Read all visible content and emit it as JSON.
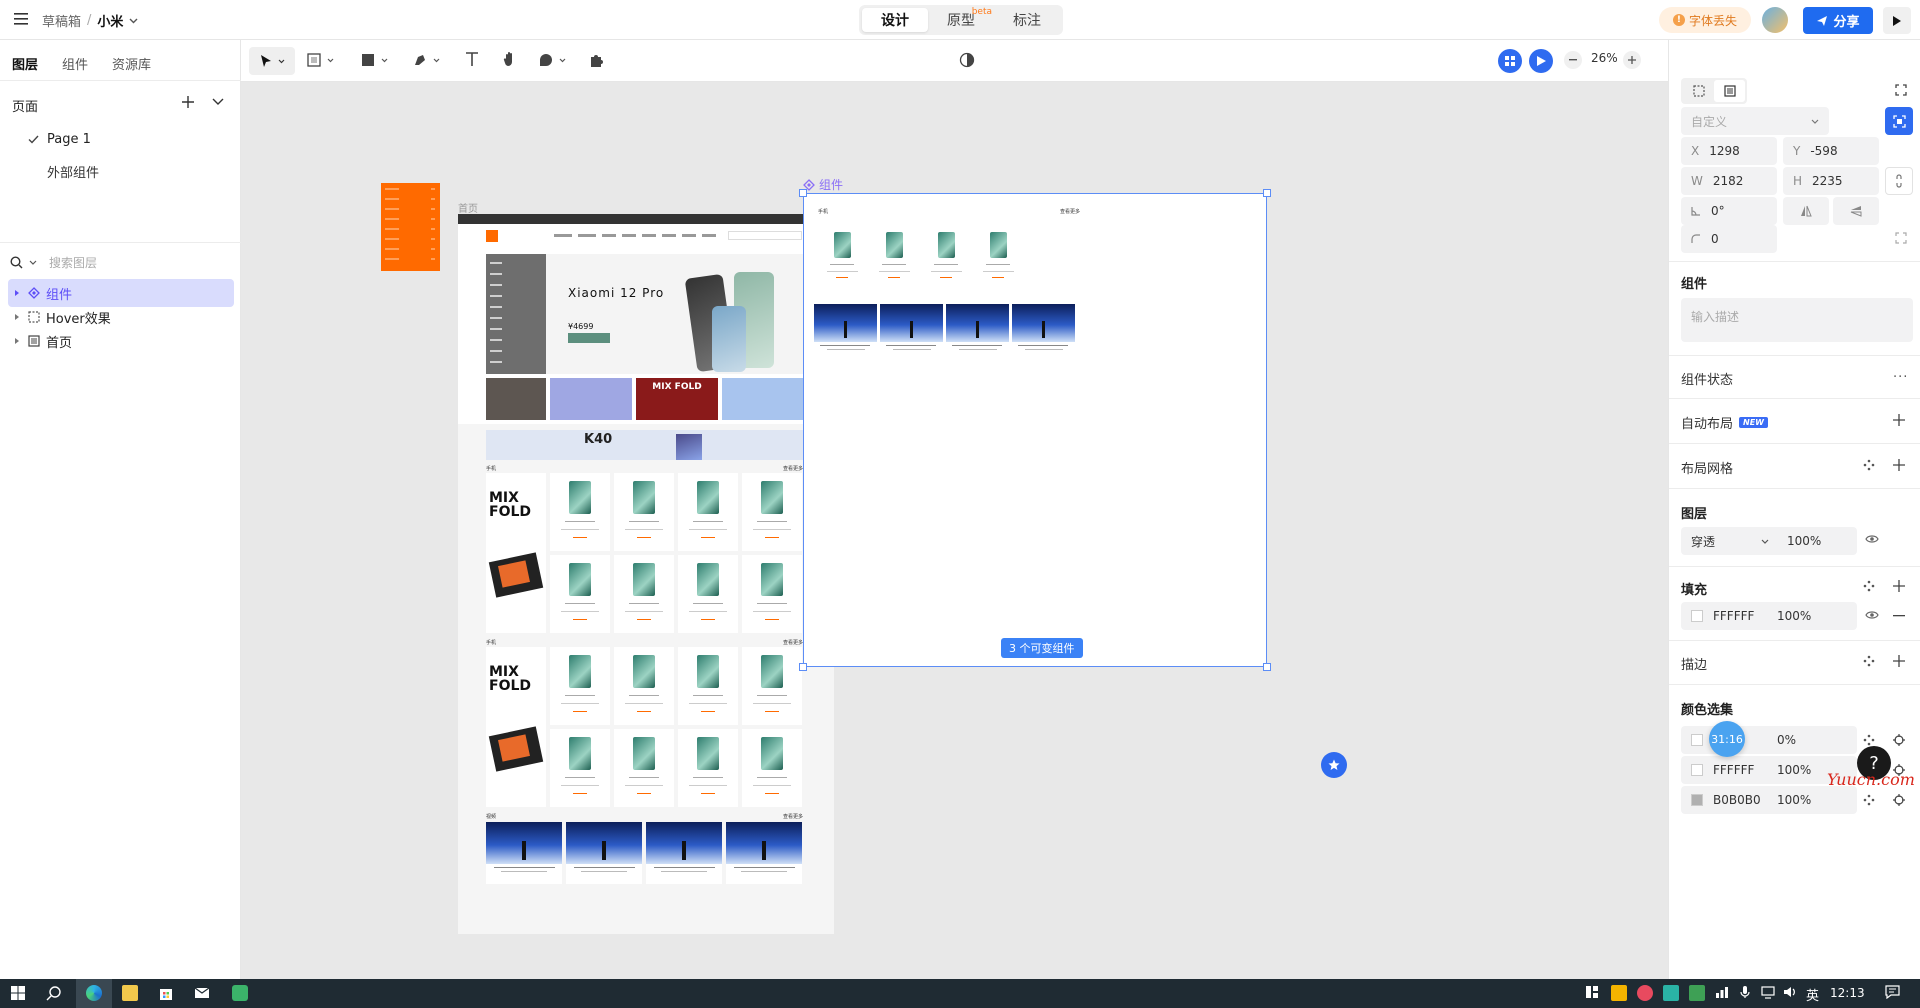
{
  "topbar": {
    "breadcrumb_root": "草稿箱",
    "separator": "/",
    "file_name": "小米",
    "modes": [
      "设计",
      "原型",
      "标注"
    ],
    "beta_label": "beta",
    "font_missing_label": "字体丢失",
    "share_label": "分享"
  },
  "left_panel": {
    "tabs": [
      "图层",
      "组件",
      "资源库"
    ],
    "pages_title": "页面",
    "pages": [
      "Page 1",
      "外部组件"
    ],
    "search_placeholder": "搜索图层",
    "layers": [
      "组件",
      "Hover效果",
      "首页"
    ]
  },
  "toolbar": {
    "zoom": "26%"
  },
  "canvas": {
    "frame_label_home": "首页",
    "component_label": "组件",
    "variant_badge": "3 个可变组件",
    "mini": {
      "hero_brand": "Xiaomi 12 Pro",
      "hero_price": "¥4699",
      "promo_mixfold": "MIX FOLD",
      "banner_k40": "K40",
      "section_phone": "手机",
      "section_video": "视频",
      "mixfold_card": "MIX FOLD",
      "more_link": "查看更多"
    }
  },
  "right_panel": {
    "preset_placeholder": "自定义",
    "x_label": "X",
    "x_value": "1298",
    "y_label": "Y",
    "y_value": "-598",
    "w_label": "W",
    "w_value": "2182",
    "h_label": "H",
    "h_value": "2235",
    "rotation": "0°",
    "radius": "0",
    "component_title": "组件",
    "description_placeholder": "输入描述",
    "component_state": "组件状态",
    "auto_layout": "自动布局",
    "new_badge": "NEW",
    "layout_grid": "布局网格",
    "layer_title": "图层",
    "blend_mode": "穿透",
    "layer_opacity": "100%",
    "fill_title": "填充",
    "fill_hex": "FFFFFF",
    "fill_opacity": "100%",
    "stroke_title": "描边",
    "color_sets_title": "颜色选集",
    "color_sets": [
      {
        "hex": "",
        "opacity": "0%",
        "color": "#ffffff"
      },
      {
        "hex": "FFFFFF",
        "opacity": "100%",
        "color": "#ffffff"
      },
      {
        "hex": "B0B0B0",
        "opacity": "100%",
        "color": "#b0b0b0"
      }
    ],
    "timer": "31:16"
  },
  "taskbar": {
    "ime": "英",
    "time": "12:13"
  },
  "watermark": "Yuucn.com",
  "colors": {
    "accent": "#5b5bf6",
    "brand": "#1f6bf0",
    "orange": "#ff6a00",
    "selection": "#5c8df6"
  }
}
